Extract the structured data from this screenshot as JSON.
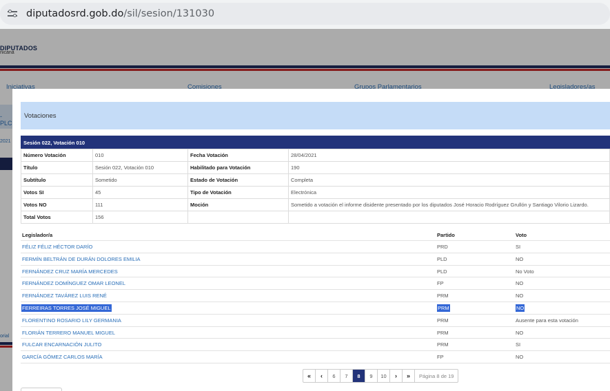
{
  "browser": {
    "url_domain": "diputadosrd.gob.do",
    "url_path": "/sil/sesion/131030"
  },
  "site": {
    "brand": "DIPUTADOS",
    "brand_sub": "nicana",
    "nav": [
      "Iniciativas",
      "Comisiones",
      "Grupos Parlamentarios",
      "Legisladores/as"
    ],
    "side_fragment_1": "-PLC",
    "side_fragment_2": "2021",
    "side_fragment_3": "orial"
  },
  "modal": {
    "header": "Votaciones",
    "section_title": "Sesión 022, Votación 010",
    "info": {
      "numero_label": "Número Votación",
      "numero": "010",
      "fecha_label": "Fecha Votación",
      "fecha": "28/04/2021",
      "titulo_label": "Título",
      "titulo": "Sesión 022, Votación 010",
      "habilitado_label": "Habilitado para Votación",
      "habilitado": "190",
      "subtitulo_label": "Subtítulo",
      "subtitulo": "Sometido",
      "estado_label": "Estado de Votación",
      "estado": "Completa",
      "si_label": "Votos SI",
      "si": "45",
      "tipo_label": "Tipo de Votación",
      "tipo": "Electrónica",
      "no_label": "Votos NO",
      "no": "111",
      "mocion_label": "Moción",
      "mocion": "Sometido a votación el informe disidente presentado por los diputados José Horacio Rodríguez Grullón y Santiago Vilorio Lizardo.",
      "total_label": "Total Votos",
      "total": "156"
    },
    "votes_headers": {
      "legislador": "Legislador/a",
      "partido": "Partido",
      "voto": "Voto"
    },
    "votes": [
      {
        "name": "FÉLIZ FÉLIZ HÉCTOR DARÍO",
        "party": "PRD",
        "vote": "SI"
      },
      {
        "name": "FERMÍN BELTRÁN DE DURÁN DOLORES EMILIA",
        "party": "PLD",
        "vote": "NO"
      },
      {
        "name": "FERNÁNDEZ CRUZ MARÍA MERCEDES",
        "party": "PLD",
        "vote": "No Voto"
      },
      {
        "name": "FERNÁNDEZ DOMÍNGUEZ OMAR LEONEL",
        "party": "FP",
        "vote": "NO"
      },
      {
        "name": "FERNÁNDEZ TAVÁREZ LUIS RENÉ",
        "party": "PRM",
        "vote": "NO"
      },
      {
        "name": "FERREIRAS TORRES JOSÉ MIGUEL",
        "party": "PRM",
        "vote": "NO"
      },
      {
        "name": "FLORENTINO ROSARIO LILY GERMANIA",
        "party": "PRM",
        "vote": "Ausente para esta votación"
      },
      {
        "name": "FLORIÁN TERRERO MANUEL MIGUEL",
        "party": "PRM",
        "vote": "NO"
      },
      {
        "name": "FULCAR ENCARNACIÓN JULITO",
        "party": "PRM",
        "vote": "SI"
      },
      {
        "name": "GARCÍA GÓMEZ CARLOS MARÍA",
        "party": "FP",
        "vote": "NO"
      }
    ],
    "pager": {
      "first": "«",
      "prev": "‹",
      "next": "›",
      "last": "»",
      "pages": [
        "6",
        "7",
        "8",
        "9",
        "10"
      ],
      "current": "8",
      "info": "Página 8 de 19"
    }
  }
}
